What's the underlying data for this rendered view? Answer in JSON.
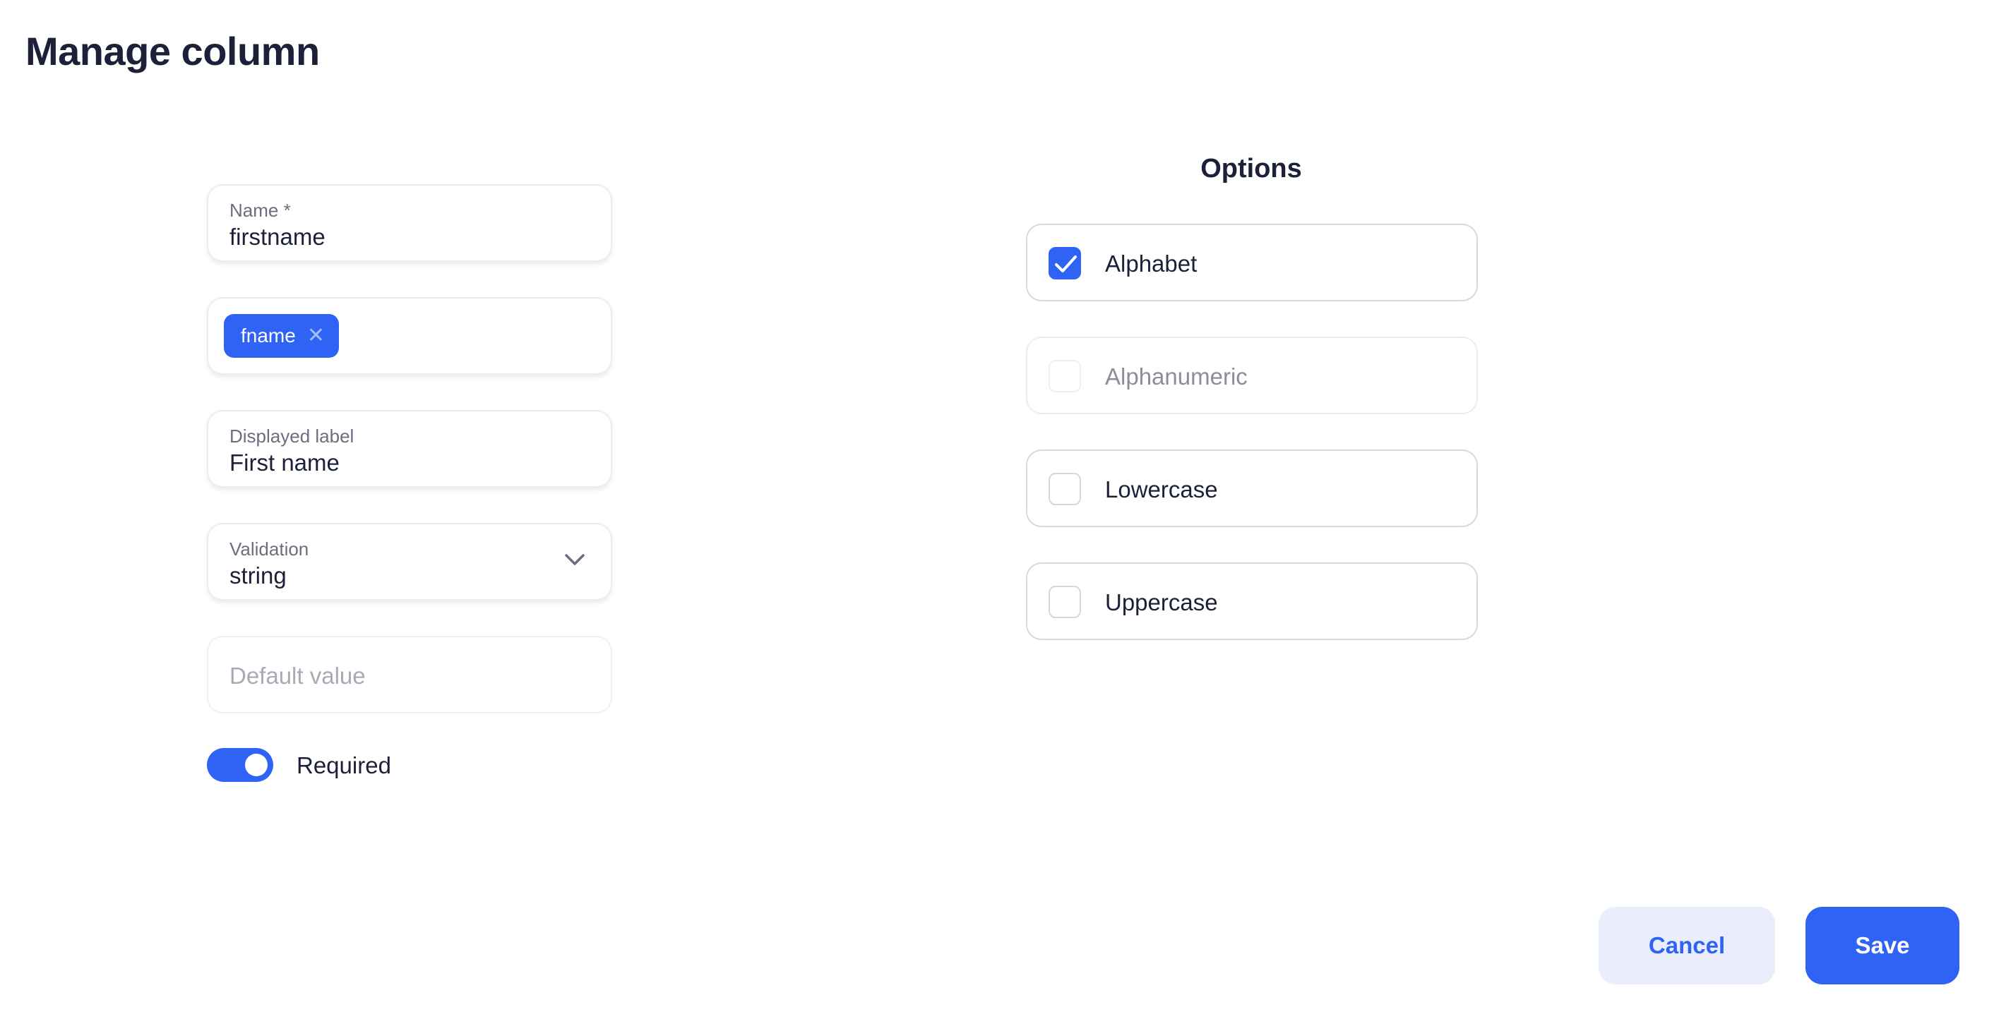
{
  "header": {
    "title": "Manage column"
  },
  "form": {
    "name": {
      "label": "Name *",
      "value": "firstname"
    },
    "aliases": {
      "chips": [
        {
          "label": "fname",
          "remove_icon": "close-icon"
        }
      ]
    },
    "displayed_label": {
      "label": "Displayed label",
      "value": "First name"
    },
    "validation": {
      "label": "Validation",
      "value": "string",
      "icon": "chevron-down-icon"
    },
    "default_value": {
      "placeholder": "Default value",
      "value": ""
    },
    "required": {
      "label": "Required",
      "enabled": true
    }
  },
  "options": {
    "title": "Options",
    "items": [
      {
        "label": "Alphabet",
        "checked": true,
        "disabled": false
      },
      {
        "label": "Alphanumeric",
        "checked": false,
        "disabled": true
      },
      {
        "label": "Lowercase",
        "checked": false,
        "disabled": false
      },
      {
        "label": "Uppercase",
        "checked": false,
        "disabled": false
      }
    ]
  },
  "footer": {
    "cancel_label": "Cancel",
    "save_label": "Save"
  },
  "colors": {
    "accent": "#2f63f5",
    "text": "#1c2039",
    "muted": "#6b6e80",
    "cancel_bg": "#eaeefc"
  }
}
